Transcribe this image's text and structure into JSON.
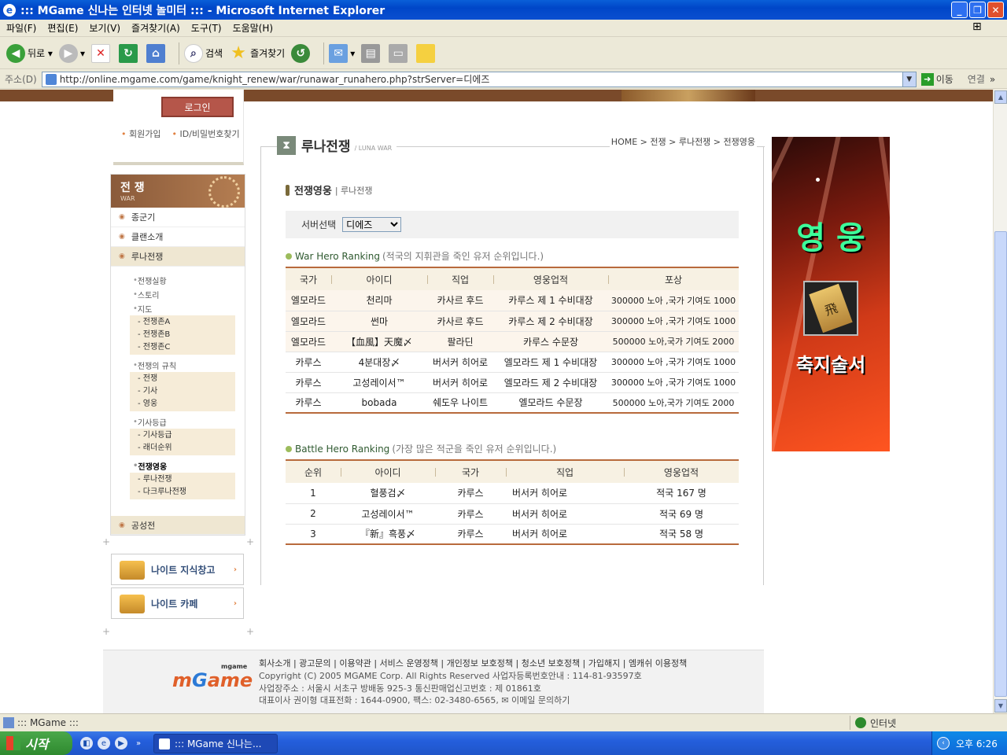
{
  "window": {
    "title": "::: MGame 신나는 인터넷 놀미터 ::: - Microsoft Internet Explorer"
  },
  "menu": [
    "파일(F)",
    "편집(E)",
    "보기(V)",
    "즐겨찾기(A)",
    "도구(T)",
    "도움말(H)"
  ],
  "toolbar": {
    "back": "뒤로",
    "search": "검색",
    "favorites": "즐겨찾기"
  },
  "address": {
    "label": "주소(D)",
    "url": "http://online.mgame.com/game/knight_renew/war/runawar_runahero.php?strServer=디에즈",
    "go": "이동",
    "links": "연결"
  },
  "login": {
    "button": "로그인",
    "signup": "회원가입",
    "find": "ID/비밀번호찾기"
  },
  "sidenav": {
    "title": "전 쟁",
    "subtitle": "WAR",
    "items": [
      "종군기",
      "클랜소개",
      "루나전쟁",
      "공성전"
    ],
    "sub": {
      "status": "전쟁실황",
      "story": "스토리",
      "map": "지도",
      "map_items": [
        "전쟁존A",
        "전쟁존B",
        "전쟁존C"
      ],
      "rules": "전쟁의 규칙",
      "rules_items": [
        "전쟁",
        "기사",
        "영웅"
      ],
      "knight": "기사등급",
      "knight_items": [
        "기사등급",
        "래더순위"
      ],
      "hero": "전쟁영웅",
      "hero_items": [
        "루나전쟁",
        "다크루나전쟁"
      ]
    }
  },
  "promos": [
    "나이트 지식창고",
    "나이트 카페"
  ],
  "page": {
    "title": "루나전쟁",
    "title_en": "/ LUNA WAR",
    "breadcrumb": "HOME > 전쟁 > 루나전쟁 > 전쟁영웅",
    "section": "전쟁영웅",
    "section_sub": "| 루나전쟁",
    "server_label": "서버선택",
    "server_value": "디에즈"
  },
  "war_hero": {
    "title": "War Hero Ranking",
    "desc": "(적국의 지휘관을 죽인 유저 순위입니다.)",
    "headers": [
      "국가",
      "아이디",
      "직업",
      "영웅업적",
      "포상"
    ],
    "rows": [
      [
        "엘모라드",
        "천리마",
        "카사르 후드",
        "카루스 제 1 수비대장",
        "300000 노아 ,국가 기여도 1000"
      ],
      [
        "엘모라드",
        "썬마",
        "카사르 후드",
        "카루스 제 2 수비대장",
        "300000 노아 ,국가 기여도 1000"
      ],
      [
        "엘모라드",
        "【血風】天魔〆",
        "팔라딘",
        "카루스 수문장",
        "500000 노아,국가 기여도 2000"
      ],
      [
        "카루스",
        "4분대장〆",
        "버서커 히어로",
        "엘모라드 제 1 수비대장",
        "300000 노아 ,국가 기여도 1000"
      ],
      [
        "카루스",
        "고성레이서™",
        "버서커 히어로",
        "엘모라드 제 2 수비대장",
        "300000 노아 ,국가 기여도 1000"
      ],
      [
        "카루스",
        "bobada",
        "쉐도우 나이트",
        "엘모라드 수문장",
        "500000 노아,국가 기여도 2000"
      ]
    ]
  },
  "battle_hero": {
    "title": "Battle Hero Ranking",
    "desc": "(가장 많은 적군을 죽인 유저 순위입니다.)",
    "headers": [
      "순위",
      "아이디",
      "국가",
      "직업",
      "영웅업적"
    ],
    "rows": [
      [
        "1",
        "혈풍검〆",
        "카루스",
        "버서커 히어로",
        "적국 167 명"
      ],
      [
        "2",
        "고성레이서™",
        "카루스",
        "버서커 히어로",
        "적국 69 명"
      ],
      [
        "3",
        "『新』흑풍〆",
        "카루스",
        "버서커 히어로",
        "적국 58 명"
      ]
    ]
  },
  "ad": {
    "title": "영 웅",
    "item": "축지술서",
    "glyph": "飛"
  },
  "footer": {
    "logo_small": "mgame",
    "links": "회사소개 | 광고문의 | 이용약관 | 서비스 운영정책 | 개인정보 보호정책 | 청소년 보호정책 | 가입해지 | 엠캐쉬 이용정책",
    "line1": "Copyright (C) 2005 MGAME Corp. All Rights Reserved 사업자등록번호안내 : 114-81-93597호",
    "line2": "사업장주소 : 서울시 서초구 방배동 925-3 통신판매업신고번호 : 제 01861호",
    "line3": "대표이사 권이형 대표전화 : 1644-0900, 팩스: 02-3480-6565, ✉ 이메일 문의하기"
  },
  "status": {
    "text": "::: MGame :::",
    "zone": "인터넷"
  },
  "taskbar": {
    "start": "시작",
    "task": "::: MGame 신나는...",
    "clock": "오후 6:26"
  }
}
